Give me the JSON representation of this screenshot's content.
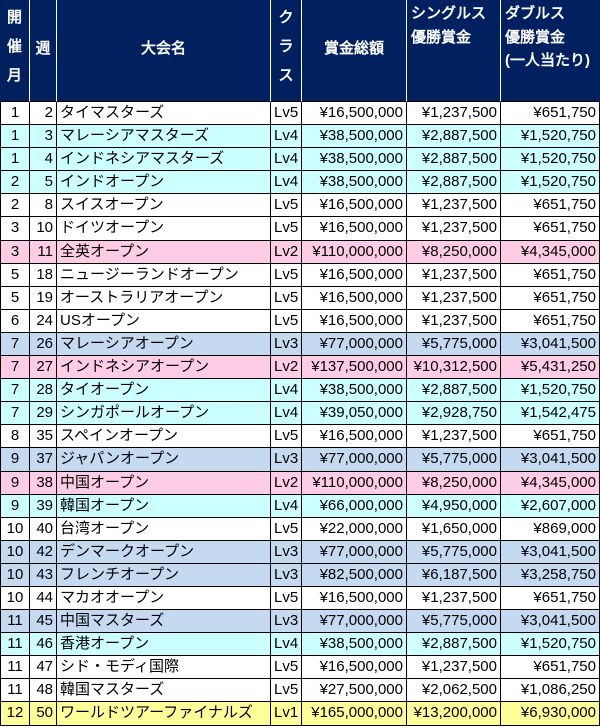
{
  "header": {
    "month": "開催月",
    "week": "週",
    "tournament": "大会名",
    "class": "クラス",
    "total_prize": "賞金総額",
    "singles_lines": [
      "シングルス",
      "優勝賞金"
    ],
    "doubles_lines": [
      "ダブルス",
      "優勝賞金",
      "(一人当たり)"
    ]
  },
  "colors": {
    "header_background": "#002060",
    "header_text": "#FFFFFF",
    "class_row_backgrounds": {
      "Lv1": "#FFFF99",
      "Lv2": "#FFCCE5",
      "Lv3": "#C5D9F1",
      "Lv4": "#CCFFFF",
      "Lv5": "#FFFFFF"
    }
  },
  "rows": [
    {
      "month": "1",
      "week": "2",
      "tournament": "タイマスターズ",
      "class": "Lv5",
      "total_prize": "¥16,500,000",
      "singles_prize": "¥1,237,500",
      "doubles_prize": "¥651,750"
    },
    {
      "month": "1",
      "week": "3",
      "tournament": "マレーシアマスターズ",
      "class": "Lv4",
      "total_prize": "¥38,500,000",
      "singles_prize": "¥2,887,500",
      "doubles_prize": "¥1,520,750"
    },
    {
      "month": "1",
      "week": "4",
      "tournament": "インドネシアマスターズ",
      "class": "Lv4",
      "total_prize": "¥38,500,000",
      "singles_prize": "¥2,887,500",
      "doubles_prize": "¥1,520,750"
    },
    {
      "month": "2",
      "week": "5",
      "tournament": "インドオープン",
      "class": "Lv4",
      "total_prize": "¥38,500,000",
      "singles_prize": "¥2,887,500",
      "doubles_prize": "¥1,520,750"
    },
    {
      "month": "2",
      "week": "8",
      "tournament": "スイスオープン",
      "class": "Lv5",
      "total_prize": "¥16,500,000",
      "singles_prize": "¥1,237,500",
      "doubles_prize": "¥651,750"
    },
    {
      "month": "3",
      "week": "10",
      "tournament": "ドイツオープン",
      "class": "Lv5",
      "total_prize": "¥16,500,000",
      "singles_prize": "¥1,237,500",
      "doubles_prize": "¥651,750"
    },
    {
      "month": "3",
      "week": "11",
      "tournament": "全英オープン",
      "class": "Lv2",
      "total_prize": "¥110,000,000",
      "singles_prize": "¥8,250,000",
      "doubles_prize": "¥4,345,000"
    },
    {
      "month": "5",
      "week": "18",
      "tournament": "ニュージーランドオープン",
      "class": "Lv5",
      "total_prize": "¥16,500,000",
      "singles_prize": "¥1,237,500",
      "doubles_prize": "¥651,750"
    },
    {
      "month": "5",
      "week": "19",
      "tournament": "オーストラリアオープン",
      "class": "Lv5",
      "total_prize": "¥16,500,000",
      "singles_prize": "¥1,237,500",
      "doubles_prize": "¥651,750"
    },
    {
      "month": "6",
      "week": "24",
      "tournament": "USオープン",
      "class": "Lv5",
      "total_prize": "¥16,500,000",
      "singles_prize": "¥1,237,500",
      "doubles_prize": "¥651,750"
    },
    {
      "month": "7",
      "week": "26",
      "tournament": "マレーシアオープン",
      "class": "Lv3",
      "total_prize": "¥77,000,000",
      "singles_prize": "¥5,775,000",
      "doubles_prize": "¥3,041,500"
    },
    {
      "month": "7",
      "week": "27",
      "tournament": "インドネシアオープン",
      "class": "Lv2",
      "total_prize": "¥137,500,000",
      "singles_prize": "¥10,312,500",
      "doubles_prize": "¥5,431,250"
    },
    {
      "month": "7",
      "week": "28",
      "tournament": "タイオープン",
      "class": "Lv4",
      "total_prize": "¥38,500,000",
      "singles_prize": "¥2,887,500",
      "doubles_prize": "¥1,520,750"
    },
    {
      "month": "7",
      "week": "29",
      "tournament": "シンガポールオープン",
      "class": "Lv4",
      "total_prize": "¥39,050,000",
      "singles_prize": "¥2,928,750",
      "doubles_prize": "¥1,542,475"
    },
    {
      "month": "8",
      "week": "35",
      "tournament": "スペインオープン",
      "class": "Lv5",
      "total_prize": "¥16,500,000",
      "singles_prize": "¥1,237,500",
      "doubles_prize": "¥651,750"
    },
    {
      "month": "9",
      "week": "37",
      "tournament": "ジャパンオープン",
      "class": "Lv3",
      "total_prize": "¥77,000,000",
      "singles_prize": "¥5,775,000",
      "doubles_prize": "¥3,041,500"
    },
    {
      "month": "9",
      "week": "38",
      "tournament": "中国オープン",
      "class": "Lv2",
      "total_prize": "¥110,000,000",
      "singles_prize": "¥8,250,000",
      "doubles_prize": "¥4,345,000"
    },
    {
      "month": "9",
      "week": "39",
      "tournament": "韓国オープン",
      "class": "Lv4",
      "total_prize": "¥66,000,000",
      "singles_prize": "¥4,950,000",
      "doubles_prize": "¥2,607,000"
    },
    {
      "month": "10",
      "week": "40",
      "tournament": "台湾オープン",
      "class": "Lv5",
      "total_prize": "¥22,000,000",
      "singles_prize": "¥1,650,000",
      "doubles_prize": "¥869,000"
    },
    {
      "month": "10",
      "week": "42",
      "tournament": "デンマークオープン",
      "class": "Lv3",
      "total_prize": "¥77,000,000",
      "singles_prize": "¥5,775,000",
      "doubles_prize": "¥3,041,500"
    },
    {
      "month": "10",
      "week": "43",
      "tournament": "フレンチオープン",
      "class": "Lv3",
      "total_prize": "¥82,500,000",
      "singles_prize": "¥6,187,500",
      "doubles_prize": "¥3,258,750"
    },
    {
      "month": "10",
      "week": "44",
      "tournament": "マカオオープン",
      "class": "Lv5",
      "total_prize": "¥16,500,000",
      "singles_prize": "¥1,237,500",
      "doubles_prize": "¥651,750"
    },
    {
      "month": "11",
      "week": "45",
      "tournament": "中国マスターズ",
      "class": "Lv3",
      "total_prize": "¥77,000,000",
      "singles_prize": "¥5,775,000",
      "doubles_prize": "¥3,041,500"
    },
    {
      "month": "11",
      "week": "46",
      "tournament": "香港オープン",
      "class": "Lv4",
      "total_prize": "¥38,500,000",
      "singles_prize": "¥2,887,500",
      "doubles_prize": "¥1,520,750"
    },
    {
      "month": "11",
      "week": "47",
      "tournament": "シド・モディ国際",
      "class": "Lv5",
      "total_prize": "¥16,500,000",
      "singles_prize": "¥1,237,500",
      "doubles_prize": "¥651,750"
    },
    {
      "month": "11",
      "week": "48",
      "tournament": "韓国マスターズ",
      "class": "Lv5",
      "total_prize": "¥27,500,000",
      "singles_prize": "¥2,062,500",
      "doubles_prize": "¥1,086,250"
    },
    {
      "month": "12",
      "week": "50",
      "tournament": "ワールドツアーファイナルズ",
      "class": "Lv1",
      "total_prize": "¥165,000,000",
      "singles_prize": "¥13,200,000",
      "doubles_prize": "¥6,930,000"
    }
  ]
}
